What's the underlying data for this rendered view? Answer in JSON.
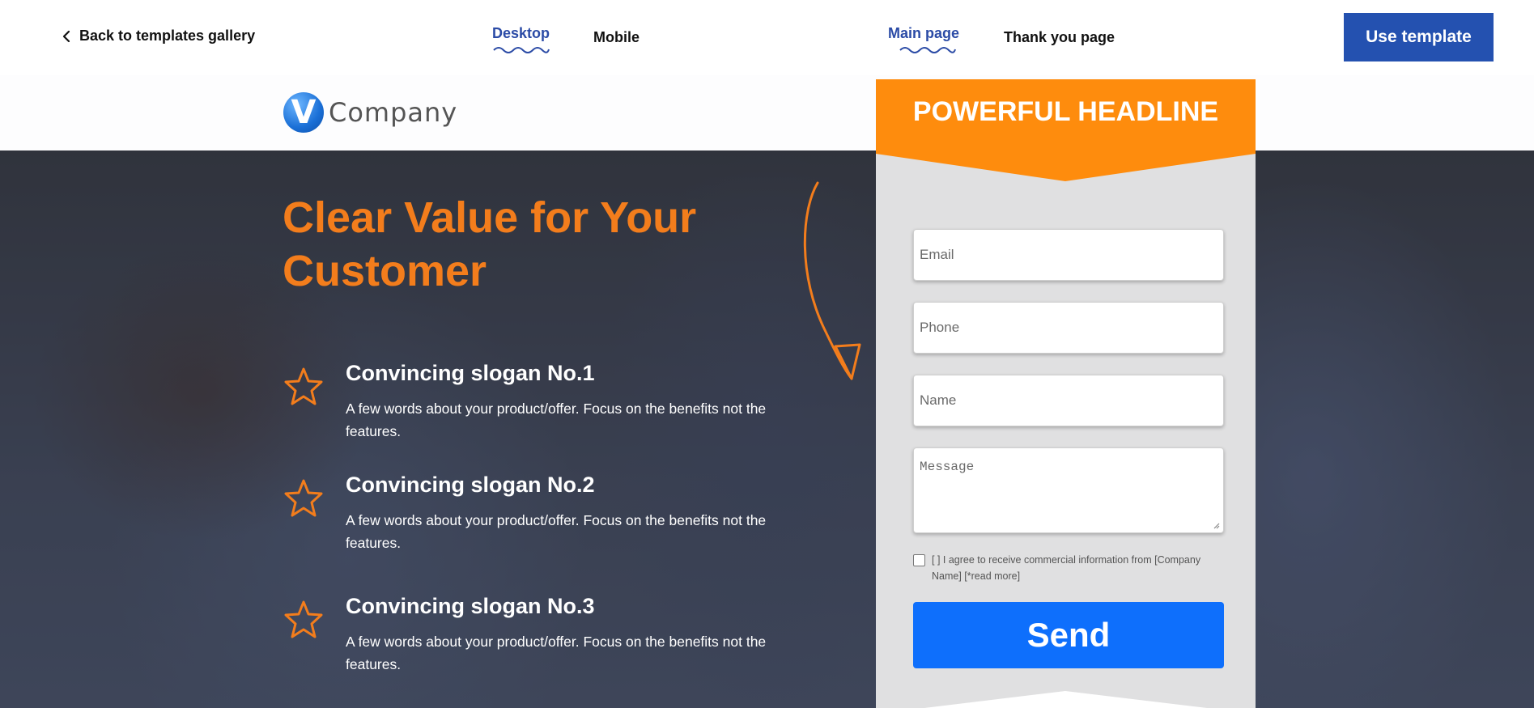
{
  "toolbar": {
    "back_label": "Back to templates gallery",
    "device_active": "Desktop",
    "device_other": "Mobile",
    "page_active": "Main page",
    "page_other": "Thank you page",
    "use_template_label": "Use template"
  },
  "logo": {
    "mark": "V",
    "text": "Company"
  },
  "hero": {
    "title": "Clear Value for Your Customer",
    "features": [
      {
        "title": "Convincing slogan No.1",
        "text": "A few words about your product/offer. Focus on the benefits not the features."
      },
      {
        "title": "Convincing slogan No.2",
        "text": "A few words about your product/offer. Focus on the benefits not the features."
      },
      {
        "title": "Convincing slogan No.3",
        "text": "A few words about your product/offer. Focus on the benefits not the features."
      }
    ]
  },
  "form": {
    "headline": "POWERFUL HEADLINE",
    "email_placeholder": "Email",
    "phone_placeholder": "Phone",
    "name_placeholder": "Name",
    "message_placeholder": "Message",
    "consent_text": "[ ] I agree to receive commercial information from [Company Name] [*read more]",
    "send_label": "Send"
  },
  "colors": {
    "accent_orange": "#f37d1c",
    "headline_orange": "#fe8c0d",
    "toolbar_blue": "#2451b0",
    "send_blue": "#0e6ffc",
    "active_tab_blue": "#2b4ba6"
  },
  "icons": {
    "back": "chevron-left-icon",
    "feature": "star-outline-icon",
    "decoration": "curved-arrow-icon"
  }
}
